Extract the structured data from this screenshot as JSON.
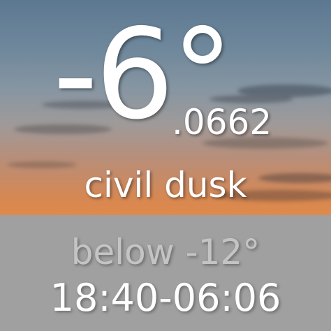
{
  "weather": {
    "temperature_main": "-6°",
    "temperature_fraction": ".0662",
    "phase_label": "civil dusk"
  },
  "next_phase": {
    "threshold_label": "below -12°",
    "time_range": "18:40-06:06"
  },
  "colors": {
    "panel_background": "#a0a0a0",
    "primary_text": "#ffffff",
    "dim_text": "#c4c4c4"
  }
}
